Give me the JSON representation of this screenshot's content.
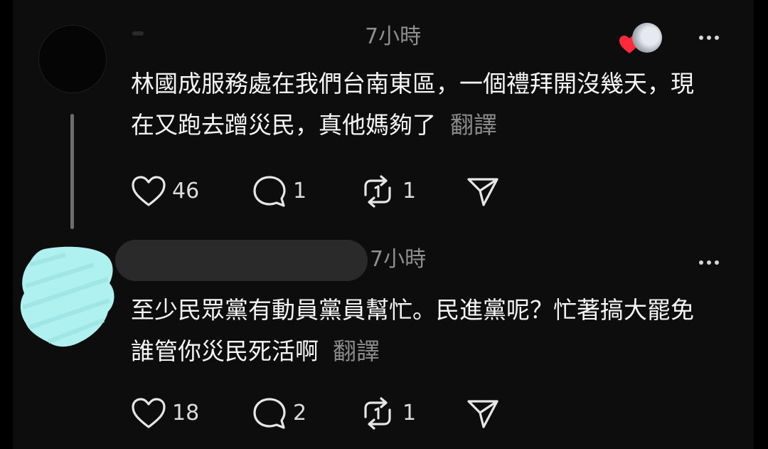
{
  "posts": [
    {
      "time": "7小時",
      "text": "林國成服務處在我們台南東區，一個禮拜開沒幾天，現在又跑去蹭災民，真他媽夠了",
      "translate_label": "翻譯",
      "likes": "46",
      "replies": "1",
      "reposts": "1"
    },
    {
      "time": "7小時",
      "text": "至少民眾黨有動員黨員幫忙。民進黨呢？忙著搞大罷免誰管你災民死活啊",
      "translate_label": "翻譯",
      "likes": "18",
      "replies": "2",
      "reposts": "1"
    }
  ],
  "icons": {
    "like": "heart-icon",
    "reply": "comment-bubble-icon",
    "repost": "repost-arrows-icon",
    "share": "send-paper-plane-icon",
    "more": "more-dots-icon",
    "liked_by": "red-heart-icon"
  },
  "colors": {
    "background": "#0d0d0e",
    "text": "#f5f5f5",
    "muted": "#8e8e8e",
    "liked_heart": "#ff2b3b",
    "redaction": "#aef1ef"
  }
}
